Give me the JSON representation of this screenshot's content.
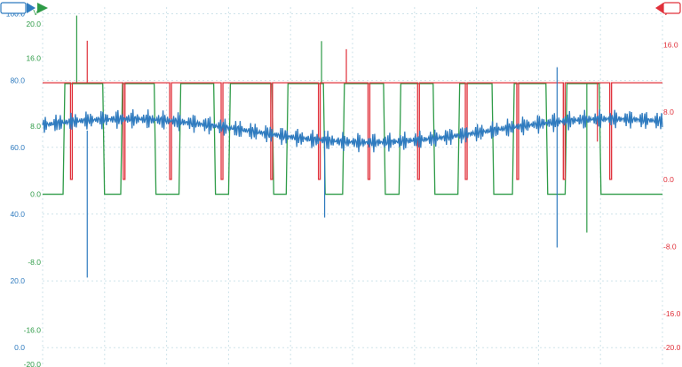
{
  "chart_data": {
    "type": "line",
    "title": "",
    "colors": {
      "voltage_a": "#2e9b47",
      "voltage_b": "#e0303a",
      "current": "#2f7bbf",
      "grid": "#cfe3ea"
    },
    "x": {
      "range": [
        0,
        10
      ],
      "grid_divisions": 10,
      "tick_labels": []
    },
    "axes": [
      {
        "id": "voltage_a",
        "unit": "V",
        "side": "left",
        "color": "#2e9b47",
        "range": [
          -20,
          22
        ],
        "ticks": [
          "20.0",
          "16.0",
          "8.0",
          "0.0",
          "-8.0",
          "-16.0",
          "-20.0"
        ]
      },
      {
        "id": "current",
        "unit": "A",
        "side": "left",
        "color": "#2f7bbf",
        "range": [
          -5,
          102
        ],
        "ticks": [
          "100.0",
          "80.0",
          "60.0",
          "40.0",
          "20.0",
          "0.0"
        ]
      },
      {
        "id": "voltage_b",
        "unit": "V",
        "side": "right",
        "color": "#e0303a",
        "range": [
          -22,
          20.5
        ],
        "ticks": [
          "20.0",
          "16.0",
          "8.0",
          "0.0",
          "-8.0",
          "-16.0",
          "-20.0"
        ]
      }
    ],
    "series": [
      {
        "axis": "voltage_a",
        "kind": "square",
        "high": 13.0,
        "low": 0.0,
        "rises": [
          0.33,
          1.26,
          2.2,
          3.0,
          3.93,
          4.84,
          5.75,
          6.7,
          7.58,
          8.43
        ],
        "falls": [
          0.97,
          1.8,
          2.76,
          3.7,
          4.53,
          5.5,
          6.3,
          7.25,
          8.12,
          8.98
        ],
        "spikes": [
          {
            "x": 0.55,
            "v": 21.0
          },
          {
            "x": 4.5,
            "v": 18.0
          },
          {
            "x": 8.78,
            "v": -4.5
          }
        ]
      },
      {
        "axis": "voltage_b",
        "kind": "dips",
        "base": 11.5,
        "low": 0.0,
        "dips": [
          0.45,
          1.3,
          2.05,
          2.88,
          3.68,
          4.45,
          5.25,
          6.05,
          6.82,
          7.65,
          8.4,
          9.15
        ],
        "spikes": [
          {
            "x": 0.72,
            "v": 16.5
          },
          {
            "x": 4.9,
            "v": 15.5
          },
          {
            "x": 8.95,
            "v": 4.5
          }
        ]
      },
      {
        "axis": "current",
        "kind": "noisy",
        "mean": 65,
        "ripple": 3,
        "wave": 3.5,
        "spikes": [
          {
            "x": 0.72,
            "v": 21
          },
          {
            "x": 4.55,
            "v": 39
          },
          {
            "x": 8.3,
            "v": 30
          },
          {
            "x": 8.3,
            "v": 84
          }
        ]
      }
    ]
  },
  "markers": {
    "left_label": "",
    "right_label": ""
  }
}
